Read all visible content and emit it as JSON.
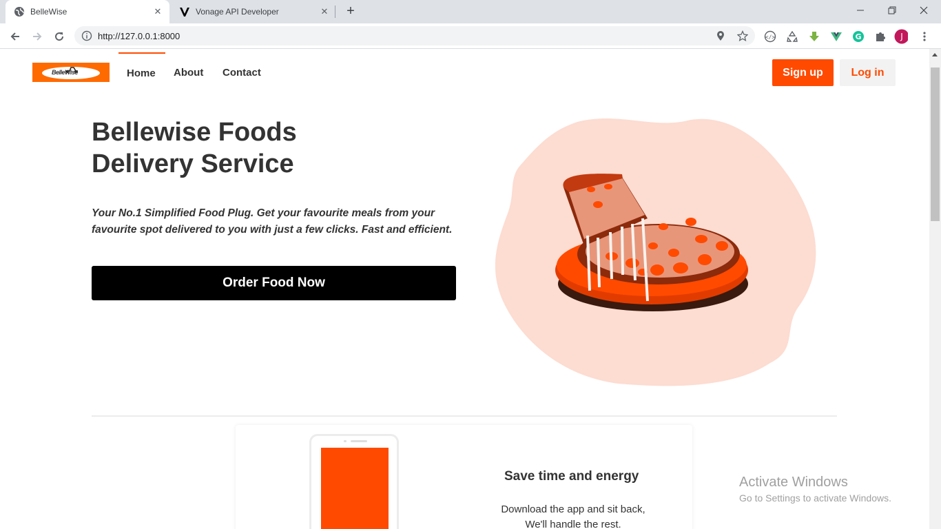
{
  "browser": {
    "tabs": [
      {
        "title": "BelleWise",
        "active": true
      },
      {
        "title": "Vonage API Developer",
        "active": false
      }
    ],
    "url": "http://127.0.0.1:8000",
    "profile_initial": "J",
    "accent_color": "#ff4a00"
  },
  "site": {
    "logo_text": "BelleWise",
    "nav": [
      {
        "label": "Home",
        "active": true
      },
      {
        "label": "About",
        "active": false
      },
      {
        "label": "Contact",
        "active": false
      }
    ],
    "signup_label": "Sign up",
    "login_label": "Log in"
  },
  "hero": {
    "title_line1": "Bellewise Foods",
    "title_line2": "Delivery Service",
    "subtitle": "Your No.1 Simplified Food Plug. Get your favourite meals from your favourite spot delivered to you with just a few clicks. Fast and efficient.",
    "cta_label": "Order Food Now",
    "image_icon": "pizza-illustration"
  },
  "feature": {
    "title": "Save time and energy",
    "text_line1": "Download the app and sit back,",
    "text_line2": "We'll handle the rest."
  },
  "os": {
    "watermark_title": "Activate Windows",
    "watermark_sub": "Go to Settings to activate Windows."
  }
}
